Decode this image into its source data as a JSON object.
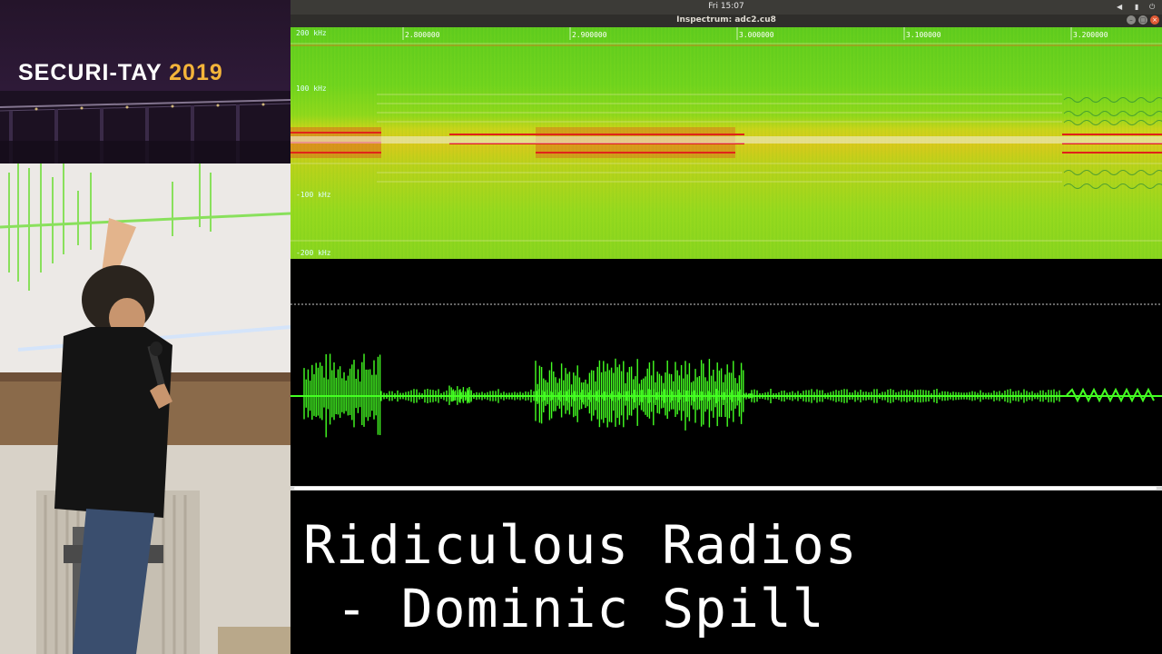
{
  "banner": {
    "title_main": "SECURI-TAY",
    "title_year": "2019"
  },
  "system": {
    "clock": "Fri 15:07"
  },
  "window": {
    "title": "Inspectrum: adc2.cu8"
  },
  "spectrogram": {
    "freq_labels": [
      "200 kHz",
      "100 kHz",
      "-100 kHz",
      "-200 kHz"
    ],
    "time_labels": [
      "2.800000",
      "2.900000",
      "3.000000",
      "3.100000",
      "3.200000"
    ]
  },
  "caption": {
    "line1": "Ridiculous Radios",
    "line2": " - Dominic Spill"
  },
  "colors": {
    "accent_year": "#f4b43a",
    "waveform": "#44ff22",
    "signal_band": "#e0201a"
  },
  "icons": [
    "network-icon",
    "battery-icon",
    "power-icon",
    "minimize-icon",
    "maximize-icon",
    "close-icon"
  ]
}
